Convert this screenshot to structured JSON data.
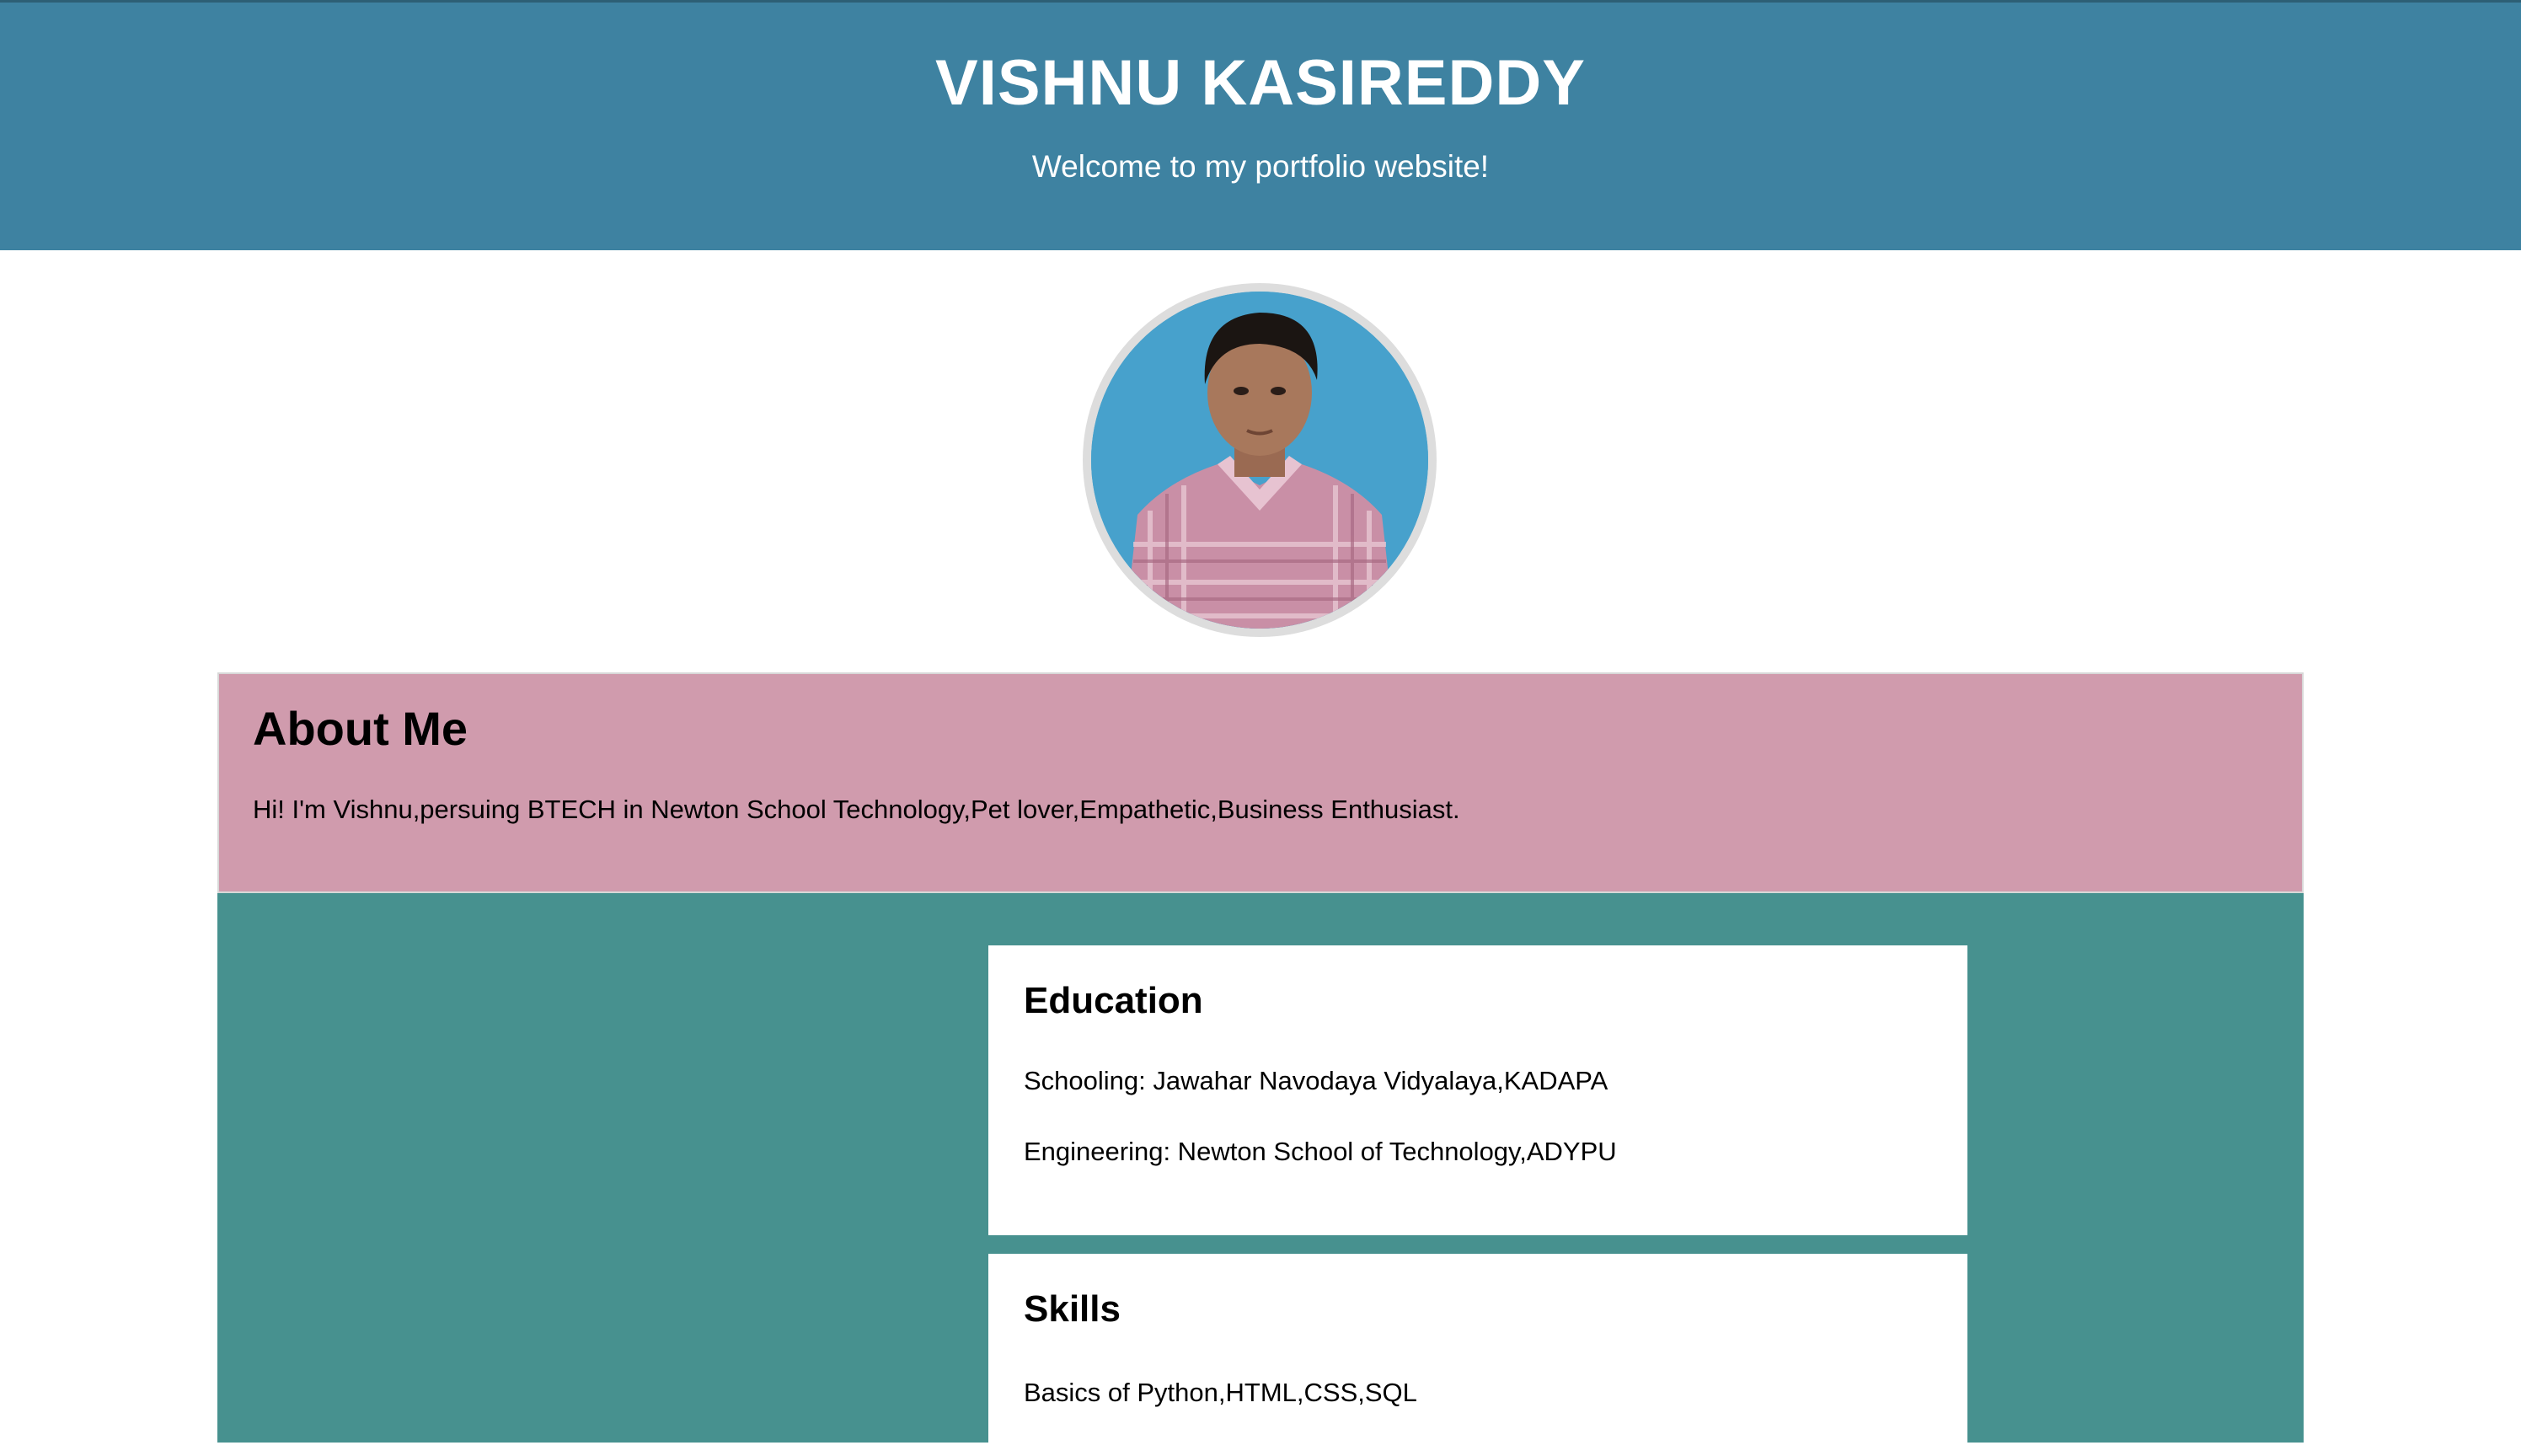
{
  "header": {
    "title": "VISHNU KASIREDDY",
    "subtitle": "Welcome to my portfolio website!"
  },
  "about": {
    "heading": "About Me",
    "text": "Hi! I'm Vishnu,persuing BTECH in Newton School Technology,Pet lover,Empathetic,Business Enthusiast."
  },
  "education": {
    "heading": "Education",
    "schooling": "Schooling: Jawahar Navodaya Vidyalaya,KADAPA",
    "engineering": "Engineering: Newton School of Technology,ADYPU"
  },
  "skills": {
    "heading": "Skills",
    "text": "Basics of Python,HTML,CSS,SQL"
  },
  "colors": {
    "header_bg": "#3e82a1",
    "about_bg": "#d09bad",
    "section_bg": "#47918f",
    "card_bg": "#ffffff"
  }
}
